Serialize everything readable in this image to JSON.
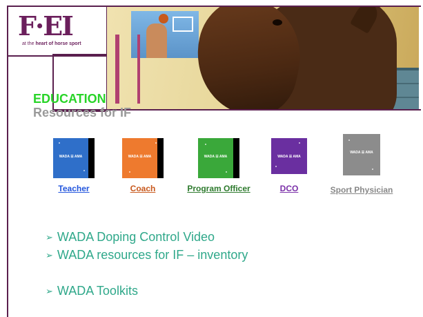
{
  "logo": {
    "text": "F·EI",
    "tag_prefix": "at the ",
    "tag_bold": "heart of horse sport"
  },
  "heading": {
    "title": "EDUCATION",
    "subtitle": "Resources for IF"
  },
  "thumbnail_text": "WADA ☰ AMA",
  "resources": [
    {
      "label": "Teacher",
      "color": "#2255dd",
      "thumb": "#2f6fc9"
    },
    {
      "label": "Coach",
      "color": "#c8581c",
      "thumb": "#ee7a2e"
    },
    {
      "label": "Program Officer",
      "color": "#2d7a2d",
      "thumb": "#3aa83a"
    },
    {
      "label": "DCO",
      "color": "#7a2fa8",
      "thumb": "#6a2fa0"
    },
    {
      "label": "Sport Physician",
      "color": "#888888",
      "thumb": "#8c8c8c"
    }
  ],
  "links": [
    {
      "text": "WADA Doping Control Video"
    },
    {
      "text": "WADA resources for IF – inventory"
    },
    {
      "text": ""
    },
    {
      "text": "WADA Toolkits"
    }
  ],
  "colors": {
    "frame": "#5a1f4e",
    "title": "#28d428",
    "subtitle": "#9a9a9a",
    "link": "#2fa88a"
  }
}
